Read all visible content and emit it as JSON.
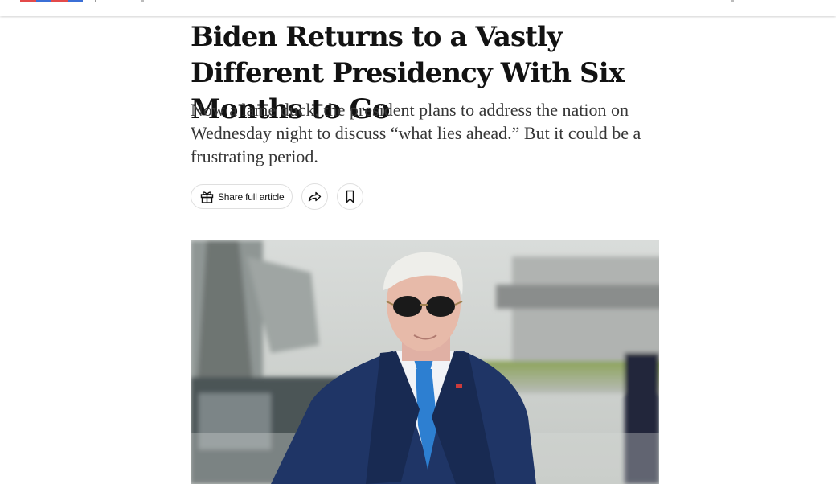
{
  "colors": {
    "logo_strip": [
      "#e34a4a",
      "#3b6fd6",
      "#e34a4a",
      "#3b6fd6"
    ],
    "headline": "#121212",
    "summary": "#363636",
    "suit": "#1f3566",
    "tie": "#2d7fd1"
  },
  "article": {
    "headline": "Biden Returns to a Vastly Different Presidency With Six Months to Go",
    "summary": "Now a lame duck, the president plans to address the nation on Wednesday night to discuss “what lies ahead.” But it could be a frustrating period."
  },
  "actions": {
    "share_full_article": {
      "label": "Share full article",
      "icon": "gift-icon"
    },
    "share": {
      "icon": "share-arrow-icon"
    },
    "save": {
      "icon": "bookmark-icon"
    }
  },
  "lead_image": {
    "subject": "photograph"
  }
}
